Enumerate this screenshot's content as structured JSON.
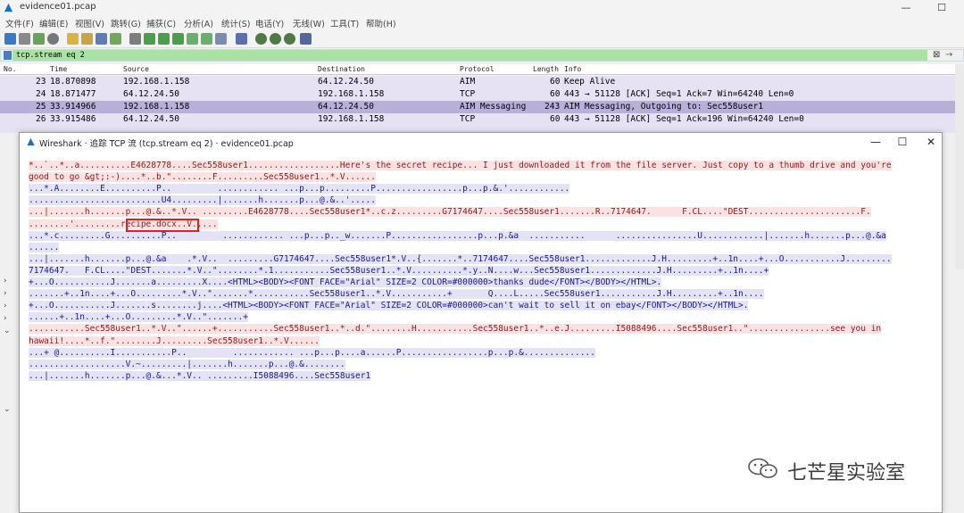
{
  "window": {
    "title": "evidence01.pcap"
  },
  "menu": [
    "文件(F)",
    "编辑(E)",
    "视图(V)",
    "跳转(G)",
    "捕获(C)",
    "分析(A)",
    "统计(S)",
    "电话(Y)",
    "无线(W)",
    "工具(T)",
    "帮助(H)"
  ],
  "filter": {
    "value": "tcp.stream eq 2"
  },
  "packet_list": {
    "columns": [
      "No.",
      "Time",
      "Source",
      "Destination",
      "Protocol",
      "Length",
      "Info"
    ],
    "rows": [
      {
        "no": "23",
        "time": "18.870898",
        "src": "192.168.1.158",
        "dst": "64.12.24.50",
        "proto": "AIM",
        "len": "60",
        "info": "Keep Alive"
      },
      {
        "no": "24",
        "time": "18.871477",
        "src": "64.12.24.50",
        "dst": "192.168.1.158",
        "proto": "TCP",
        "len": "60",
        "info": "443 → 51128 [ACK] Seq=1 Ack=7 Win=64240 Len=0"
      },
      {
        "no": "25",
        "time": "33.914966",
        "src": "192.168.1.158",
        "dst": "64.12.24.50",
        "proto": "AIM Messaging",
        "len": "243",
        "info": "AIM Messaging, Outgoing to: Sec558user1"
      },
      {
        "no": "26",
        "time": "33.915486",
        "src": "64.12.24.50",
        "dst": "192.168.1.158",
        "proto": "TCP",
        "len": "60",
        "info": "443 → 51128 [ACK] Seq=1 Ack=196 Win=64240 Len=0"
      }
    ]
  },
  "dialog": {
    "title": "Wireshark · 追踪 TCP 流 (tcp.stream eq 2) · evidence01.pcap",
    "lines": [
      {
        "dir": "c",
        "text": "*..`..*..a..........E4628778....Sec558user1..................Here's the secret recipe... I just downloaded it from the file server. Just copy to a thumb drive and you're"
      },
      {
        "dir": "c",
        "text": "good to go &gt;:-)....*..b.\"........F.........Sec558user1..*.V......"
      },
      {
        "dir": "s",
        "text": "...*.A........E..........P..         ............ ...p...p.........P.................p...p.&.'............"
      },
      {
        "dir": "s",
        "text": "..........................U4.........|.......h.......p...@.&..'....."
      },
      {
        "dir": "c",
        "text": "...|.......h.......p...@.&..*.V.. .........E4628778....Sec558user1*..c.z.........G7174647....Sec558user1.......R..7174647.      F.CL....\"DEST......................F."
      },
      {
        "dir": "c",
        "text": "........'.........recipe.docx..V....."
      },
      {
        "dir": "s",
        "text": "...*.c.........G..........P..         ............ ...p...p.._w.......P.................p...p.&a  ...........      ................U............|.......h.......p...@.&a"
      },
      {
        "dir": "s",
        "text": "......"
      },
      {
        "dir": "s",
        "text": "...|.......h.......p...@.&a    .*.V..  .........G7174647....Sec558user1*.V..{.......*..7174647....Sec558user1.............J.H.........+..1n....+...O...........J........."
      },
      {
        "dir": "s",
        "text": "7174647.   F.CL....\"DEST.......*.V..\"........*.1...........Sec558user1..*.V..........*.y..N....w...Sec558user1.............J.H.........+..1n....+"
      },
      {
        "dir": "s",
        "text": "+...O...........J.......a.........X....<HTML><BODY><FONT FACE=\"Arial\" SIZE=2 COLOR=#000000>thanks dude</FONT></BODY></HTML>."
      },
      {
        "dir": "s",
        "text": ".......+..1n....+...O.........*.V..\".......*...........Sec558user1..*.V...........+       Q....L.....Sec558user1...........J.H.........+..1n...."
      },
      {
        "dir": "s",
        "text": "+...O...........J.......s........j....<HTML><BODY><FONT FACE=\"Arial\" SIZE=2 COLOR=#000000>can't wait to sell it on ebay</FONT></BODY></HTML>."
      },
      {
        "dir": "s",
        "text": "......+..1n....+...O.........*.V..\".......+"
      },
      {
        "dir": "c",
        "text": "...........Sec558user1..*.V..\"......+...........Sec558user1..*..d.\"........H...........Sec558user1..*..e.J.........I5088496....Sec558user1..\"................see you in"
      },
      {
        "dir": "c",
        "text": "hawaii!....*..f.\"........J.........Sec558user1..*.V......"
      },
      {
        "dir": "s",
        "text": "...+ @..........I...........P..         ............ ...p...p....a......P.................p...p.&.............."
      },
      {
        "dir": "s",
        "text": "...................V.~.........|.......h.......p...@.&........"
      },
      {
        "dir": "s",
        "text": "...|.......h.......p...@.&...*.V.. .........I5088496....Sec558user1"
      }
    ]
  },
  "highlight": {
    "text": ".recipe.docx."
  },
  "watermark": {
    "text": "七芒星实验室"
  }
}
